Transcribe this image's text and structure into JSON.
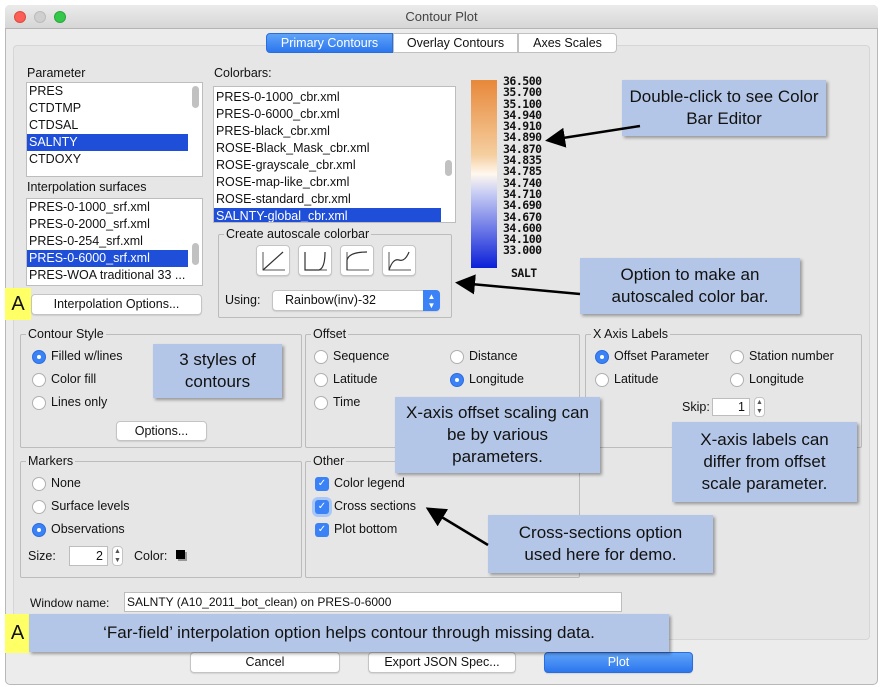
{
  "window": {
    "title": "Contour Plot"
  },
  "tabs": [
    {
      "label": "Primary Contours",
      "selected": true
    },
    {
      "label": "Overlay Contours"
    },
    {
      "label": "Axes Scales"
    }
  ],
  "parameter": {
    "label": "Parameter",
    "items": [
      "PRES",
      "CTDTMP",
      "CTDSAL",
      "SALNTY",
      "CTDOXY"
    ],
    "selected": "SALNTY"
  },
  "surfaces": {
    "label": "Interpolation surfaces",
    "items": [
      "PRES-0-1000_srf.xml",
      "PRES-0-2000_srf.xml",
      "PRES-0-254_srf.xml",
      "PRES-0-6000_srf.xml",
      "PRES-WOA traditional 33 ..."
    ],
    "selected": "PRES-0-6000_srf.xml"
  },
  "interp_button": "Interpolation Options...",
  "colorbars": {
    "label": "Colorbars:",
    "items": [
      "PRES-0-1000_cbr.xml",
      "PRES-0-6000_cbr.xml",
      "PRES-black_cbr.xml",
      "ROSE-Black_Mask_cbr.xml",
      "ROSE-grayscale_cbr.xml",
      "ROSE-map-like_cbr.xml",
      "ROSE-standard_cbr.xml",
      "SALNTY-global_cbr.xml"
    ],
    "selected": "SALNTY-global_cbr.xml"
  },
  "autoscale": {
    "label": "Create autoscale colorbar",
    "buttons": [
      "linear-curve-icon",
      "exponential-curve-icon",
      "logarithmic-curve-icon",
      "sigmoid-curve-icon"
    ],
    "using_label": "Using:",
    "using_value": "Rainbow(inv)-32"
  },
  "colorbar_preview": {
    "values": [
      "36.500",
      "35.700",
      "35.100",
      "34.940",
      "34.910",
      "34.890",
      "34.870",
      "34.835",
      "34.785",
      "34.740",
      "34.710",
      "34.690",
      "34.670",
      "34.600",
      "34.100",
      "33.000"
    ],
    "param": "SALT",
    "colors": {
      "high": "#e8883a",
      "mid": "#fff8ee",
      "low": "#0a1fd8"
    }
  },
  "contour_style": {
    "label": "Contour Style",
    "options": [
      "Filled w/lines",
      "Color fill",
      "Lines only"
    ],
    "selected": "Filled w/lines",
    "button": "Options..."
  },
  "offset": {
    "label": "Offset",
    "options": [
      "Sequence",
      "Distance",
      "Latitude",
      "Longitude",
      "Time"
    ],
    "selected": "Longitude"
  },
  "x_axis_labels": {
    "label": "X Axis Labels",
    "options": [
      "Offset Parameter",
      "Station number",
      "Latitude",
      "Longitude"
    ],
    "selected": "Offset Parameter",
    "skip_label": "Skip:",
    "skip_value": "1"
  },
  "markers": {
    "label": "Markers",
    "options": [
      "None",
      "Surface levels",
      "Observations"
    ],
    "selected": "Observations",
    "size_label": "Size:",
    "size_value": "2",
    "color_label": "Color:",
    "color": "#000000"
  },
  "other": {
    "label": "Other",
    "options": [
      "Color legend",
      "Cross sections",
      "Plot bottom"
    ],
    "checked": [
      true,
      true,
      true
    ]
  },
  "window_name": {
    "label": "Window name:",
    "value": "SALNTY (A10_2011_bot_clean) on PRES-0-6000"
  },
  "buttons": {
    "cancel": "Cancel",
    "export": "Export JSON Spec...",
    "plot": "Plot"
  },
  "annotations": {
    "colorbar_editor": "Double-click to see Color Bar Editor",
    "autoscale": "Option to make an autoscaled color bar.",
    "styles": "3 styles of contours",
    "offset": "X-axis offset scaling can be by various parameters.",
    "xlabels": "X-axis labels can differ from offset scale parameter.",
    "cross": "Cross-sections option used here for demo.",
    "farfield": "‘Far-field’ interpolation option helps contour through missing data.",
    "marker_a1": "A",
    "marker_a2": "A"
  },
  "accent": "#2c76ee",
  "annotation_bg": "#b4c6e7"
}
